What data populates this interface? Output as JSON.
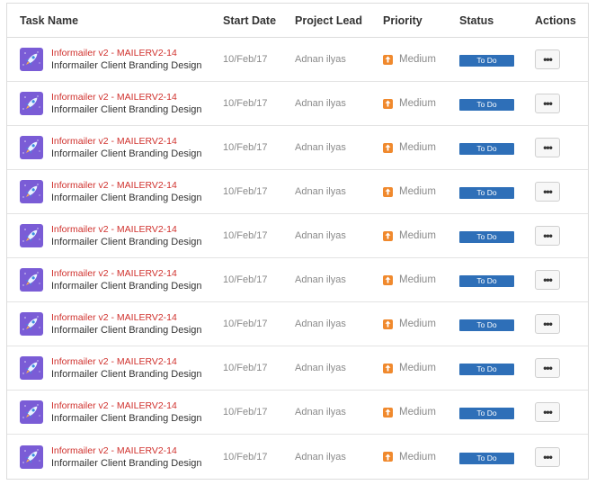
{
  "columns": {
    "task": "Task Name",
    "start": "Start Date",
    "lead": "Project Lead",
    "priority": "Priority",
    "status": "Status",
    "actions": "Actions"
  },
  "rows": [
    {
      "key": "Informailer v2 - MAILERV2-14",
      "name": "Informailer Client Branding Design",
      "start": "10/Feb/17",
      "lead": "Adnan ilyas",
      "priority": "Medium",
      "status": "To Do",
      "actions": "•••"
    },
    {
      "key": "Informailer v2 - MAILERV2-14",
      "name": "Informailer Client Branding Design",
      "start": "10/Feb/17",
      "lead": "Adnan ilyas",
      "priority": "Medium",
      "status": "To Do",
      "actions": "•••"
    },
    {
      "key": "Informailer v2 - MAILERV2-14",
      "name": "Informailer Client Branding Design",
      "start": "10/Feb/17",
      "lead": "Adnan ilyas",
      "priority": "Medium",
      "status": "To Do",
      "actions": "•••"
    },
    {
      "key": "Informailer v2 - MAILERV2-14",
      "name": "Informailer Client Branding Design",
      "start": "10/Feb/17",
      "lead": "Adnan ilyas",
      "priority": "Medium",
      "status": "To Do",
      "actions": "•••"
    },
    {
      "key": "Informailer v2 - MAILERV2-14",
      "name": "Informailer Client Branding Design",
      "start": "10/Feb/17",
      "lead": "Adnan ilyas",
      "priority": "Medium",
      "status": "To Do",
      "actions": "•••"
    },
    {
      "key": "Informailer v2 - MAILERV2-14",
      "name": "Informailer Client Branding Design",
      "start": "10/Feb/17",
      "lead": "Adnan ilyas",
      "priority": "Medium",
      "status": "To Do",
      "actions": "•••"
    },
    {
      "key": "Informailer v2 - MAILERV2-14",
      "name": "Informailer Client Branding Design",
      "start": "10/Feb/17",
      "lead": "Adnan ilyas",
      "priority": "Medium",
      "status": "To Do",
      "actions": "•••"
    },
    {
      "key": "Informailer v2 - MAILERV2-14",
      "name": "Informailer Client Branding Design",
      "start": "10/Feb/17",
      "lead": "Adnan ilyas",
      "priority": "Medium",
      "status": "To Do",
      "actions": "•••"
    },
    {
      "key": "Informailer v2 - MAILERV2-14",
      "name": "Informailer Client Branding Design",
      "start": "10/Feb/17",
      "lead": "Adnan ilyas",
      "priority": "Medium",
      "status": "To Do",
      "actions": "•••"
    },
    {
      "key": "Informailer v2 - MAILERV2-14",
      "name": "Informailer Client Branding Design",
      "start": "10/Feb/17",
      "lead": "Adnan ilyas",
      "priority": "Medium",
      "status": "To Do",
      "actions": "•••"
    }
  ],
  "icons": {
    "task": "rocket-project-icon",
    "priority": "arrow-up-priority-icon",
    "actions": "more-dots-icon"
  },
  "colors": {
    "task_key": "#d0312d",
    "status_bg": "#2e6fb8",
    "priority_medium": "#f0892d",
    "project_icon_bg": "#7a5cd6"
  }
}
